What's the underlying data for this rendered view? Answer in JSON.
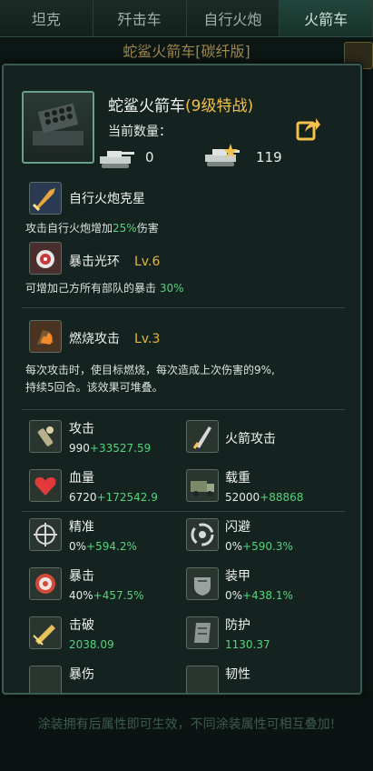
{
  "tabs": [
    "坦克",
    "歼击车",
    "自行火炮",
    "火箭车"
  ],
  "background": {
    "title": "蛇鲨火箭车[碳纤版]",
    "footer": "涂装拥有后属性即可生效，不同涂装属性可相互叠加!"
  },
  "unit": {
    "name": "蛇鲨火箭车",
    "grade": "(9级特战)",
    "count_label": "当前数量：",
    "count_normal": "0",
    "count_elite": "119"
  },
  "skills": [
    {
      "name": "自行火炮克星",
      "level": "",
      "icon": "artillery-nemesis-icon",
      "desc_pre": "攻击自行火炮增加",
      "desc_hl": "25%",
      "desc_post": "伤害"
    },
    {
      "name": "暴击光环",
      "level": "Lv.6",
      "icon": "crit-aura-icon",
      "desc_pre": "可增加己方所有部队的暴击 ",
      "desc_hl": "30%",
      "desc_post": ""
    },
    {
      "name": "燃烧攻击",
      "level": "Lv.3",
      "icon": "burn-attack-icon",
      "desc_line1": "每次攻击时，使目标燃烧，每次造成上次伤害的9%,",
      "desc_line2": "持续5回合。该效果可堆叠。"
    }
  ],
  "stats": [
    {
      "name": "攻击",
      "base": "990",
      "bonus": "+33527.59",
      "icon": "shell-icon"
    },
    {
      "name": "火箭攻击",
      "base": "",
      "bonus": "",
      "icon": "rocket-icon"
    },
    {
      "name": "血量",
      "base": "6720",
      "bonus": "+172542.9",
      "icon": "heart-icon"
    },
    {
      "name": "载重",
      "base": "52000",
      "bonus": "+88868",
      "icon": "truck-icon"
    },
    {
      "name": "精准",
      "base": "0%",
      "bonus": "+594.2%",
      "icon": "crosshair-icon"
    },
    {
      "name": "闪避",
      "base": "0%",
      "bonus": "+590.3%",
      "icon": "dodge-icon"
    },
    {
      "name": "暴击",
      "base": "40%",
      "bonus": "+457.5%",
      "icon": "crit-target-icon"
    },
    {
      "name": "装甲",
      "base": "0%",
      "bonus": "+438.1%",
      "icon": "armor-icon"
    },
    {
      "name": "击破",
      "base": "",
      "bonus": "2038.09",
      "icon": "pierce-icon"
    },
    {
      "name": "防护",
      "base": "",
      "bonus": "1130.37",
      "icon": "shield-icon"
    },
    {
      "name": "暴伤",
      "base": "",
      "bonus": "",
      "icon": "crit-damage-icon"
    },
    {
      "name": "韧性",
      "base": "",
      "bonus": "",
      "icon": "toughness-icon"
    }
  ],
  "colors": {
    "accent": "#55d47c",
    "gold": "#f2c04b",
    "panel": "#142320"
  }
}
